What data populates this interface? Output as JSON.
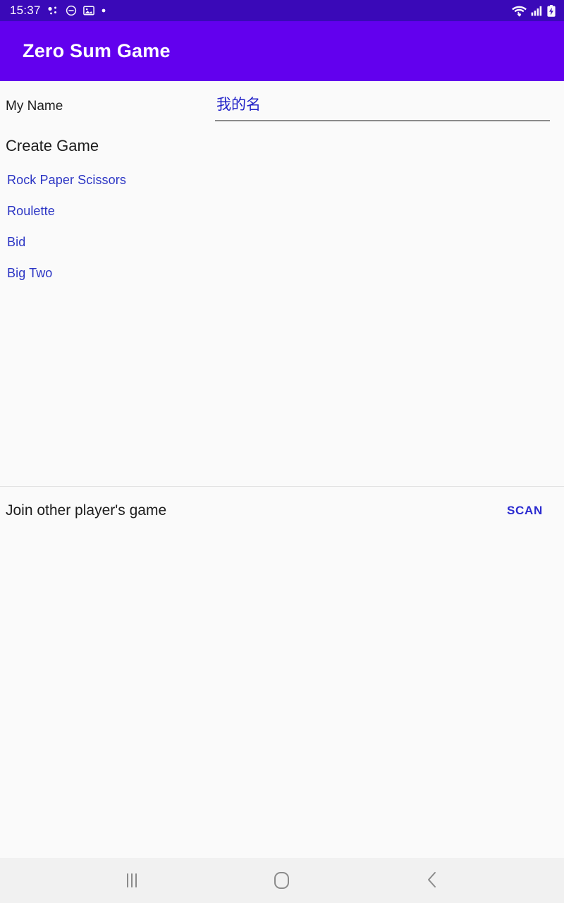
{
  "status_bar": {
    "time": "15:37",
    "left_icons": [
      "dots-cluster-icon",
      "do-not-disturb-icon",
      "image-icon",
      "small-dot-icon"
    ],
    "right_icons": [
      "wifi-icon",
      "cellular-signal-icon",
      "battery-charging-icon"
    ],
    "background_color": "#3a09b8"
  },
  "app_bar": {
    "title": "Zero Sum Game",
    "background_color": "#6200ee"
  },
  "form": {
    "name_label": "My Name",
    "name_value": "我的名",
    "name_placeholder": "My Name"
  },
  "create_section": {
    "title": "Create Game",
    "games": [
      {
        "label": "Rock Paper Scissors"
      },
      {
        "label": "Roulette"
      },
      {
        "label": "Bid"
      },
      {
        "label": "Big Two"
      }
    ]
  },
  "join_section": {
    "label": "Join other player's game",
    "scan_label": "SCAN"
  },
  "nav_bar": {
    "recent_label": "recent-apps",
    "home_label": "home",
    "back_label": "back"
  },
  "colors": {
    "accent": "#6200ee",
    "link": "#2b35c4",
    "background": "#fafafa",
    "nav_background": "#f1f1f1"
  }
}
